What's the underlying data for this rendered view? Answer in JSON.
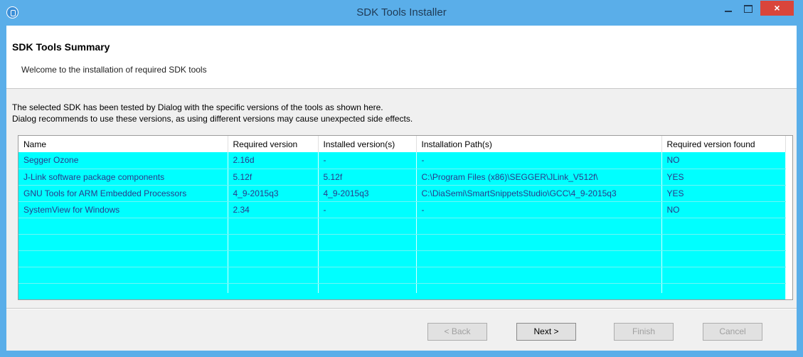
{
  "window": {
    "title": "SDK Tools Installer",
    "close_symbol": "×",
    "icon": "app-logo-icon",
    "accent_color": "#5aaee9",
    "close_color": "#d9453b"
  },
  "header": {
    "title": "SDK Tools Summary",
    "subtitle": "Welcome to the installation of required SDK tools"
  },
  "description": {
    "line1": "The selected SDK has been tested by Dialog with the specific versions of the tools as shown here.",
    "line2": "Dialog recommends to use these versions, as using different versions may cause unexpected side effects."
  },
  "table": {
    "columns": [
      "Name",
      "Required version",
      "Installed version(s)",
      "Installation Path(s)",
      "Required version found"
    ],
    "rows": [
      [
        "Segger Ozone",
        "2.16d",
        "-",
        "-",
        "NO"
      ],
      [
        "J-Link software package components",
        "5.12f",
        "5.12f",
        "C:\\Program Files (x86)\\SEGGER\\JLink_V512f\\",
        "YES"
      ],
      [
        "GNU Tools for ARM Embedded Processors",
        "4_9-2015q3",
        "4_9-2015q3",
        "C:\\DiaSemi\\SmartSnippetsStudio\\GCC\\4_9-2015q3",
        "YES"
      ],
      [
        "SystemView for Windows",
        "2.34",
        "-",
        "-",
        "NO"
      ]
    ],
    "row_color": "#00ffff"
  },
  "buttons": {
    "back": "< Back",
    "next": "Next >",
    "finish": "Finish",
    "cancel": "Cancel"
  }
}
